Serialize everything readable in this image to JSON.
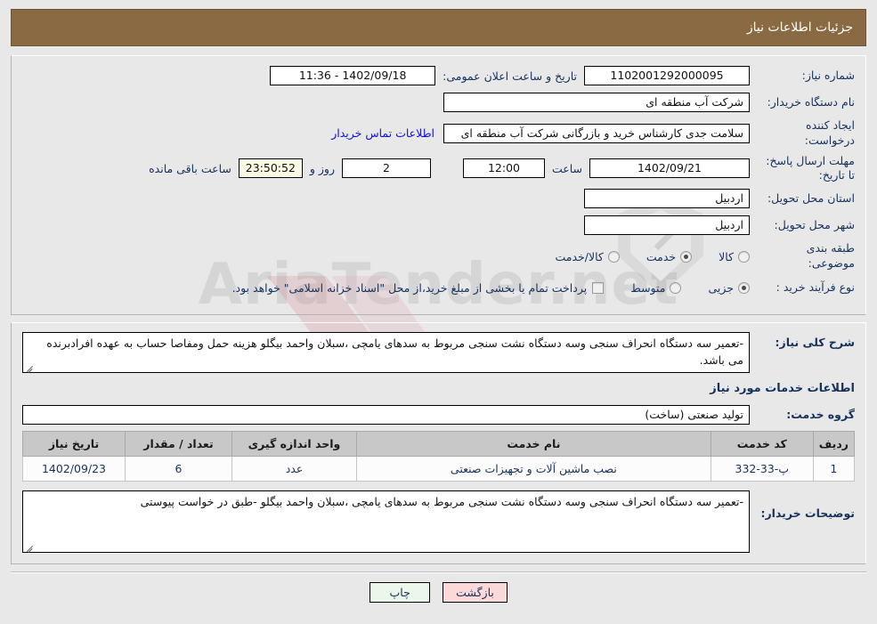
{
  "header": {
    "title": "جزئیات اطلاعات نیاز"
  },
  "form": {
    "need_number_label": "شماره نیاز:",
    "need_number_value": "1102001292000095",
    "public_announce_label": "تاریخ و ساعت اعلان عمومی:",
    "public_announce_value": "1402/09/18 - 11:36",
    "buyer_org_label": "نام دستگاه خریدار:",
    "buyer_org_value": "شرکت آب منطقه ای",
    "creator_label": "ایجاد کننده درخواست:",
    "creator_value": "سلامت جدی کارشناس خرید و بازرگانی شرکت آب منطقه ای",
    "contact_link": "اطلاعات تماس خریدار",
    "deadline_label": "مهلت ارسال پاسخ: تا تاریخ:",
    "deadline_date": "1402/09/21",
    "hour_label": "ساعت",
    "deadline_time": "12:00",
    "days_value": "2",
    "days_label": "روز و",
    "remaining_clock": "23:50:52",
    "remaining_label": "ساعت باقی مانده",
    "province_label": "استان محل تحویل:",
    "province_value": "اردبیل",
    "city_label": "شهر محل تحویل:",
    "city_value": "اردبیل",
    "category_label": "طبقه بندی موضوعی:",
    "category_options": [
      {
        "label": "کالا",
        "selected": false
      },
      {
        "label": "خدمت",
        "selected": true
      },
      {
        "label": "کالا/خدمت",
        "selected": false
      }
    ],
    "process_label": "نوع فرآیند خرید :",
    "process_options": [
      {
        "label": "جزیی",
        "selected": true
      },
      {
        "label": "متوسط",
        "selected": false
      }
    ],
    "treasury_checkbox_text": "پرداخت تمام یا بخشی از مبلغ خرید،از محل \"اسناد خزانه اسلامی\" خواهد بود.",
    "treasury_checked": false
  },
  "overview": {
    "label": "شرح کلی نیاز:",
    "text": "-تعمیر سه دستگاه انحراف سنجی وسه دستگاه نشت سنجی مربوط به سدهای یامچی ،سبلان واحمد بیگلو هزینه حمل ومفاصا حساب به عهده افرادبرنده می باشد."
  },
  "services": {
    "section_title": "اطلاعات خدمات مورد نیاز",
    "group_label": "گروه خدمت:",
    "group_value": "تولید صنعتی (ساخت)",
    "table": {
      "columns": [
        "ردیف",
        "کد خدمت",
        "نام خدمت",
        "واحد اندازه گیری",
        "تعداد / مقدار",
        "تاریخ نیاز"
      ],
      "rows": [
        {
          "row_no": "1",
          "service_code": "پ-33-332",
          "service_name": "نصب ماشین آلات و تجهیزات صنعتی",
          "unit": "عدد",
          "quantity": "6",
          "need_date": "1402/09/23"
        }
      ]
    }
  },
  "buyer_notes": {
    "label": "توضیحات خریدار:",
    "text": "-تعمیر سه دستگاه انحراف سنجی وسه دستگاه نشت سنجی مربوط به سدهای یامچی ،سبلان واحمد بیگلو -طبق در خواست پیوستی"
  },
  "footer": {
    "print_label": "چاپ",
    "back_label": "بازگشت"
  },
  "watermark": {
    "text": "AriaTender.net"
  },
  "colors": {
    "header_bg": "#8a6a42",
    "page_bg": "#e8e8e8",
    "label_text": "#16325c",
    "link": "#1111dd",
    "table_header_bg": "#c8c8c8",
    "print_btn": "#eaf7ea",
    "back_btn": "#fbd9d9",
    "countdown_bg": "#fbfbe3"
  }
}
